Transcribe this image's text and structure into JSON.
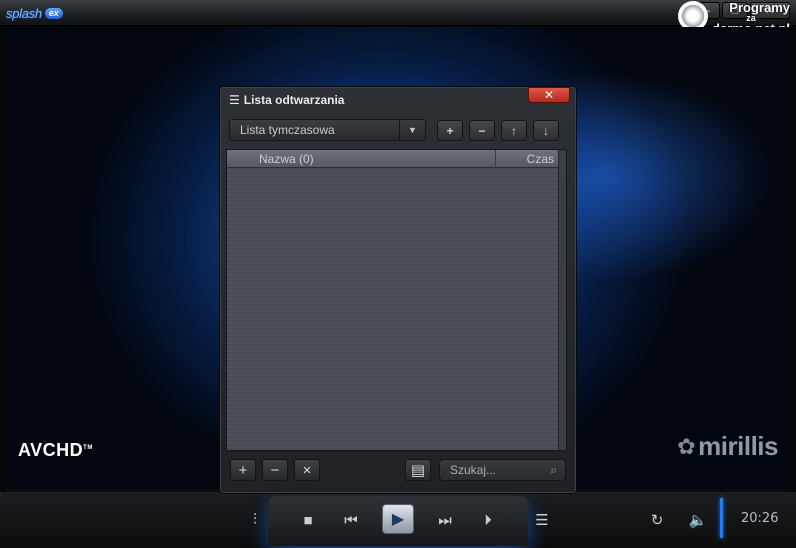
{
  "app": {
    "logo_text": "splash",
    "logo_badge": "ex"
  },
  "watermark": {
    "line1": "Programy",
    "line2": "za",
    "line3": "darmo.net.pl"
  },
  "window_controls": {
    "minimize": "–",
    "maximize": "□",
    "close": "✕"
  },
  "video": {
    "avchd_label": "AVCHD",
    "brand": "mirillis"
  },
  "playlist": {
    "title": "Lista odtwarzania",
    "close_label": "✕",
    "dropdown_value": "Lista tymczasowa",
    "columns": {
      "name": "Nazwa (0)",
      "time": "Czas"
    },
    "items": [],
    "search_placeholder": "Szukaj..."
  },
  "player": {
    "time": "20:26",
    "volume_level": 1.0
  }
}
